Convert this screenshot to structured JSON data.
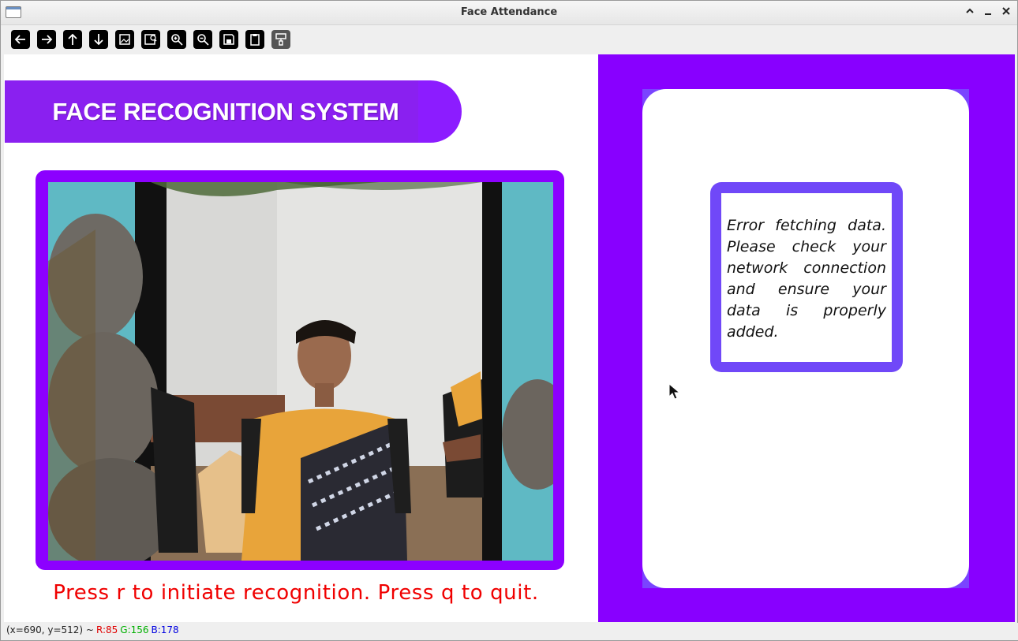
{
  "window": {
    "title": "Face Attendance",
    "controls": [
      "maximize",
      "minimize",
      "close"
    ]
  },
  "toolbar": {
    "buttons": [
      {
        "name": "pan-left-icon"
      },
      {
        "name": "pan-right-icon"
      },
      {
        "name": "pan-up-icon"
      },
      {
        "name": "pan-down-icon"
      },
      {
        "name": "zoom-original-icon"
      },
      {
        "name": "zoom-fit-icon"
      },
      {
        "name": "zoom-in-icon"
      },
      {
        "name": "zoom-out-icon"
      },
      {
        "name": "save-icon"
      },
      {
        "name": "copy-clipboard-icon"
      },
      {
        "name": "properties-icon"
      }
    ]
  },
  "banner": {
    "title": "FACE RECOGNITION SYSTEM"
  },
  "camera": {
    "prompt": "Press r to initiate recognition. Press q to quit."
  },
  "info_panel": {
    "message": "Error fetching data. Please check your network connection and ensure your data is properly added."
  },
  "status": {
    "coords": "(x=690, y=512) ~",
    "r": "R:85",
    "g": "G:156",
    "b": "B:178"
  },
  "colors": {
    "accent": "#8800ff",
    "banner": "#8c1cff",
    "message_border": "#7048f8",
    "prompt": "#f00000"
  }
}
